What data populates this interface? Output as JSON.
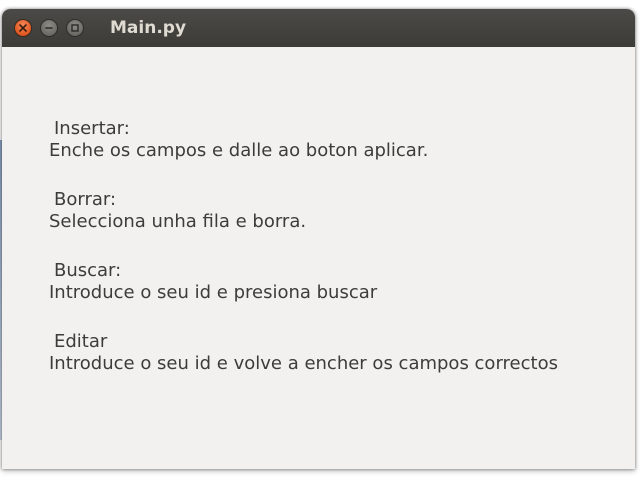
{
  "window": {
    "title": "Main.py"
  },
  "sections": [
    {
      "heading": "Insertar:",
      "description": "Enche os campos e dalle ao boton aplicar."
    },
    {
      "heading": "Borrar:",
      "description": "Selecciona unha fila e borra."
    },
    {
      "heading": "Buscar:",
      "description": "Introduce o seu id e presiona buscar"
    },
    {
      "heading": "Editar",
      "description": "Introduce o seu id e volve a encher os campos correctos"
    }
  ],
  "icons": {
    "close": "close-icon",
    "minimize": "minimize-icon",
    "maximize": "maximize-icon"
  },
  "colors": {
    "titlebar": "#3c3b37",
    "close_button": "#e05620",
    "window_background": "#f2f1f0",
    "text": "#3c3c3c"
  }
}
